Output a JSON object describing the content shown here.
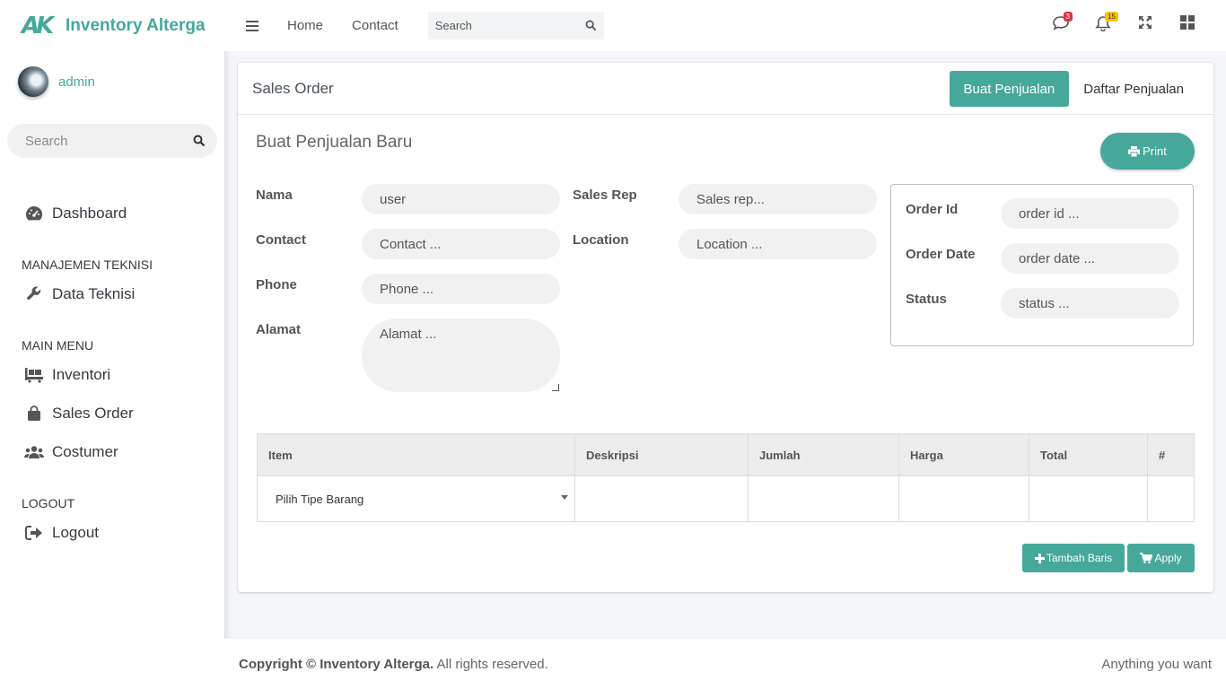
{
  "brand": {
    "logo_text": "AK",
    "name": "Inventory Alterga"
  },
  "user": {
    "name": "admin"
  },
  "sidebar": {
    "search_placeholder": "Search",
    "items": [
      {
        "type": "item",
        "label": "Dashboard",
        "icon": "dashboard-icon"
      },
      {
        "type": "header",
        "label": "MANAJEMEN TEKNISI"
      },
      {
        "type": "item",
        "label": "Data Teknisi",
        "icon": "wrench-icon"
      },
      {
        "type": "header",
        "label": "MAIN MENU"
      },
      {
        "type": "item",
        "label": "Inventori",
        "icon": "pallet-icon"
      },
      {
        "type": "item",
        "label": "Sales Order",
        "icon": "shopping-bag-icon"
      },
      {
        "type": "item",
        "label": "Costumer",
        "icon": "users-icon"
      },
      {
        "type": "header",
        "label": "LOGOUT"
      },
      {
        "type": "item",
        "label": "Logout",
        "icon": "sign-out-icon"
      }
    ]
  },
  "topbar": {
    "links": [
      "Home",
      "Contact"
    ],
    "search_placeholder": "Search",
    "messages_count": "3",
    "notifications_count": "15"
  },
  "card": {
    "title": "Sales Order",
    "tabs": [
      "Buat Penjualan",
      "Daftar Penjualan"
    ],
    "subtitle": "Buat Penjualan Baru",
    "print_label": "Print"
  },
  "form": {
    "nama_label": "Nama",
    "nama_value": "user",
    "contact_label": "Contact",
    "contact_placeholder": "Contact ...",
    "phone_label": "Phone",
    "phone_placeholder": "Phone ...",
    "alamat_label": "Alamat",
    "alamat_placeholder": "Alamat ...",
    "sales_rep_label": "Sales Rep",
    "sales_rep_placeholder": "Sales rep...",
    "location_label": "Location",
    "location_placeholder": "Location ...",
    "order_id_label": "Order Id",
    "order_id_placeholder": "order id ...",
    "order_date_label": "Order Date",
    "order_date_placeholder": "order date ...",
    "status_label": "Status",
    "status_placeholder": "status ..."
  },
  "table": {
    "headers": [
      "Item",
      "Deskripsi",
      "Jumlah",
      "Harga",
      "Total",
      "#"
    ],
    "select_value": "Pilih Tipe Barang"
  },
  "actions": {
    "add_row": "Tambah Baris",
    "apply": "Apply"
  },
  "footer": {
    "copyright_prefix": "Copyright © Inventory Alterga.",
    "copyright_suffix": " All rights reserved.",
    "tagline": "Anything you want"
  },
  "colors": {
    "accent": "#45a89a",
    "badge_red": "#dc3545",
    "badge_yellow": "#ffc107"
  }
}
